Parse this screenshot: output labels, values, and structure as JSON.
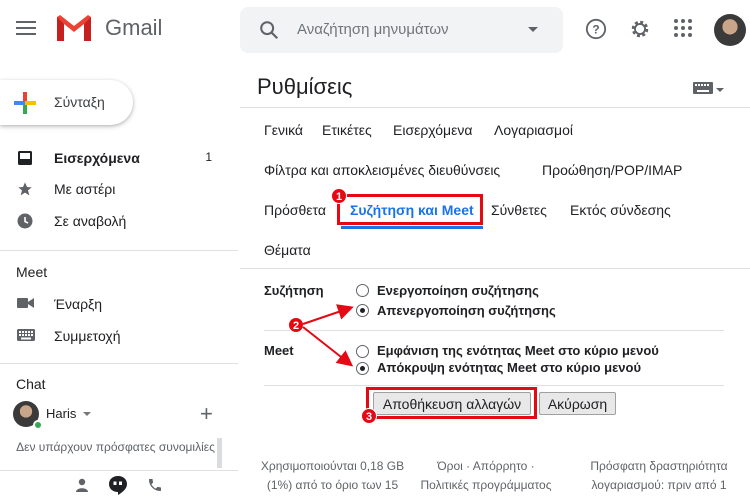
{
  "header": {
    "logo_text": "Gmail",
    "search_placeholder": "Αναζήτηση μηνυμάτων"
  },
  "sidebar": {
    "compose_label": "Σύνταξη",
    "items": [
      {
        "label": "Εισερχόμενα",
        "count": "1",
        "icon": "inbox-icon"
      },
      {
        "label": "Με αστέρι",
        "icon": "star-icon"
      },
      {
        "label": "Σε αναβολή",
        "icon": "clock-icon"
      }
    ],
    "meet_title": "Meet",
    "meet_items": [
      {
        "label": "Έναρξη",
        "icon": "video-icon"
      },
      {
        "label": "Συμμετοχή",
        "icon": "keyboard-icon"
      }
    ],
    "chat_title": "Chat",
    "chat_user": "Haris",
    "no_conversations": "Δεν υπάρχουν πρόσφατες συνομιλίες"
  },
  "main": {
    "title": "Ρυθμίσεις",
    "tabs": [
      "Γενικά",
      "Ετικέτες",
      "Εισερχόμενα",
      "Λογαριασμοί",
      "Φίλτρα και αποκλεισμένες διευθύνσεις",
      "Προώθηση/POP/IMAP",
      "Πρόσθετα",
      "Συζήτηση και Meet",
      "Σύνθετες",
      "Εκτός σύνδεσης",
      "Θέματα"
    ],
    "active_tab": "Συζήτηση και Meet",
    "chat_section": {
      "label": "Συζήτηση",
      "options": [
        "Ενεργοποίηση συζήτησης",
        "Απενεργοποίηση συζήτησης"
      ],
      "selected": 1
    },
    "meet_section": {
      "label": "Meet",
      "options": [
        "Εμφάνιση της ενότητας Meet στο κύριο μενού",
        "Απόκρυψη ενότητας Meet στο κύριο μενού"
      ],
      "selected": 1
    },
    "save_button": "Αποθήκευση αλλαγών",
    "cancel_button": "Ακύρωση",
    "footer": {
      "storage": [
        "Χρησιμοποιούνται 0,18 GB",
        "(1%) από το όριο των 15"
      ],
      "terms": [
        "Όροι · Απόρρητο ·",
        "Πολιτικές προγράμματος"
      ],
      "activity": [
        "Πρόσφατη δραστηριότητα",
        "λογαριασμού: πριν από 1"
      ]
    }
  },
  "annotations": {
    "badges": [
      "1",
      "2",
      "3"
    ],
    "color": "#e50914"
  },
  "colors": {
    "accent": "#1a73e8",
    "annotation_red": "#e50914",
    "online_green": "#34a853"
  }
}
